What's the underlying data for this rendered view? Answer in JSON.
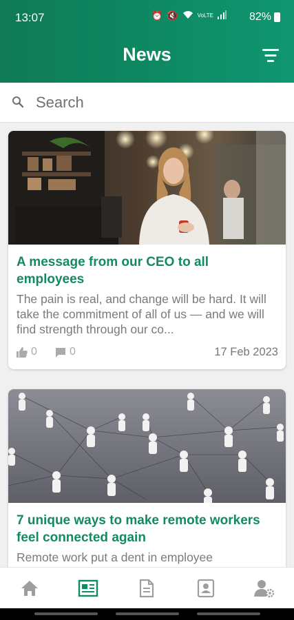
{
  "status_bar": {
    "time": "13:07",
    "battery": "82%",
    "icons": [
      "alarm-icon",
      "mute-icon",
      "wifi-icon",
      "volte-icon",
      "signal-icon",
      "battery-icon"
    ]
  },
  "header": {
    "title": "News",
    "filter_icon": "filter-icon"
  },
  "search": {
    "placeholder": "Search",
    "value": ""
  },
  "articles": [
    {
      "title": "A message from our CEO to all employees",
      "excerpt": "The pain is real, and change will be hard. It will take the commitment of all of us — and we will find strength through our co...",
      "likes": "0",
      "comments": "0",
      "date": "17 Feb 2023",
      "image": "woman-in-cafe-photo"
    },
    {
      "title": "7 unique ways to make remote workers feel connected again",
      "excerpt": "Remote work put a dent in employee",
      "image": "network-figures-photo"
    }
  ],
  "bottom_nav": {
    "items": [
      {
        "icon": "home-icon",
        "active": false
      },
      {
        "icon": "news-icon",
        "active": true
      },
      {
        "icon": "document-icon",
        "active": false
      },
      {
        "icon": "contact-card-icon",
        "active": false
      },
      {
        "icon": "user-settings-icon",
        "active": false
      }
    ]
  },
  "colors": {
    "brand": "#0e8a63",
    "title_green": "#138a60",
    "nav_active": "#0e8a63",
    "nav_inactive": "#9e9e9e"
  }
}
